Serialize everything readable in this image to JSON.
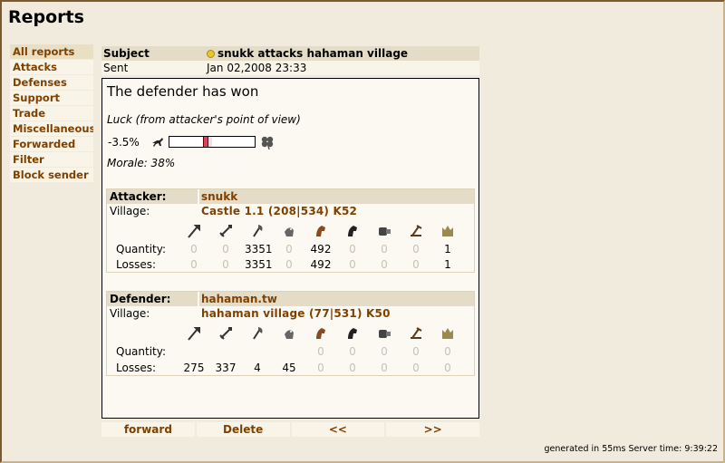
{
  "page": {
    "title": "Reports"
  },
  "sidebar": {
    "items": [
      {
        "label": "All reports",
        "selected": true
      },
      {
        "label": "Attacks"
      },
      {
        "label": "Defenses"
      },
      {
        "label": "Support"
      },
      {
        "label": "Trade"
      },
      {
        "label": "Miscellaneous"
      },
      {
        "label": "Forwarded"
      },
      {
        "label": "Filter"
      },
      {
        "label": "Block sender"
      }
    ]
  },
  "report": {
    "subject_label": "Subject",
    "subject": "snukk attacks hahaman village",
    "sent_label": "Sent",
    "sent": "Jan 02,2008 23:33",
    "result": "The defender has won",
    "luck_title": "Luck (from attacker's point of view)",
    "luck_value": "-3.5%",
    "luck_percent": -3.5,
    "morale": "Morale: 38%"
  },
  "units": [
    "spear",
    "sword",
    "axe",
    "spy",
    "light-cavalry",
    "heavy-cavalry",
    "ram",
    "catapult",
    "nobleman"
  ],
  "attacker": {
    "label": "Attacker:",
    "name": "snukk",
    "village_label": "Village:",
    "village": "Castle 1.1 (208|534) K52",
    "quantity_label": "Quantity:",
    "losses_label": "Losses:",
    "quantity": [
      "0",
      "0",
      "3351",
      "0",
      "492",
      "0",
      "0",
      "0",
      "1"
    ],
    "losses": [
      "0",
      "0",
      "3351",
      "0",
      "492",
      "0",
      "0",
      "0",
      "1"
    ]
  },
  "defender": {
    "label": "Defender:",
    "name": "hahaman.tw",
    "village_label": "Village:",
    "village": "hahaman village (77|531) K50",
    "quantity_label": "Quantity:",
    "losses_label": "Losses:",
    "quantity": [
      "",
      "",
      "",
      "",
      "0",
      "0",
      "0",
      "0",
      "0"
    ],
    "losses": [
      "275",
      "337",
      "4",
      "45",
      "0",
      "0",
      "0",
      "0",
      "0"
    ]
  },
  "nav": {
    "forward": "forward",
    "delete": "Delete",
    "prev": "<<",
    "next": ">>"
  },
  "footer": "generated in 55ms Server time: 9:39:22",
  "colors": {
    "link": "#804000",
    "header_bg": "#e4dcc6",
    "page_bg": "#f1ebdd",
    "luck_marker": "#e04060"
  }
}
